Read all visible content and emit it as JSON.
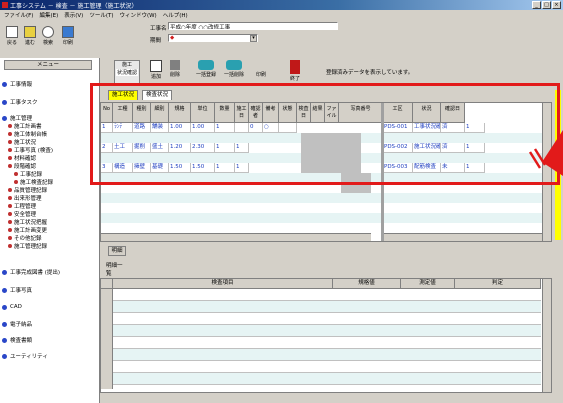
{
  "window": {
    "title": "工事システム － 検査 － 施工管理（施工状況）",
    "controls": [
      "_",
      "□",
      "×"
    ]
  },
  "menu": [
    "ファイル(F)",
    "編集(E)",
    "表示(V)",
    "ツール(T)",
    "ウィンドウ(W)",
    "ヘルプ(H)"
  ],
  "toolbar": [
    {
      "label": "戻る",
      "icon": "back-icon"
    },
    {
      "label": "進む",
      "icon": "forward-icon"
    },
    {
      "label": "検索",
      "icon": "search-icon"
    },
    {
      "label": "印刷",
      "icon": "print-icon"
    }
  ],
  "form": {
    "project_label": "工事名",
    "project_value": "平成○年度 ○○改修工事",
    "period_label": "期間",
    "period_value": "◆"
  },
  "sidebar": {
    "header": "メニュー",
    "items_top": [
      "工事情報",
      "工事タスク",
      "施工管理"
    ],
    "tree": [
      "施工計画書",
      "施工体制台帳",
      "施工状況",
      "工事写真 (検査)",
      "材料確認",
      "段階確認",
      "工事記録",
      "施工検査記録",
      "品質管理記録",
      "出来形管理",
      "工程管理",
      "安全管理",
      "施工状況把握",
      "施工計画変更",
      "その他記録",
      "施工管理記録"
    ],
    "items_bottom": [
      "工事完成図書 (提出)",
      "工事写真",
      "CAD",
      "電子納品",
      "検査書類",
      "ユーティリティ"
    ]
  },
  "ribbon": {
    "first_label": "施工",
    "first_sublabel": "状況確認",
    "buttons": [
      "追加",
      "削除",
      "一括登録",
      "一括削除",
      "印刷",
      "終了"
    ],
    "message": "登録済みデータを表示しています。"
  },
  "tabs": [
    "施工状況",
    "検査状況"
  ],
  "grid1": {
    "headers": [
      "No",
      "工種",
      "種別",
      "細別",
      "規格",
      "単位",
      "数量",
      "施工日",
      "確認者",
      "備考",
      "状態",
      "検査日",
      "結果",
      "ファイル",
      "写真番号",
      "工区",
      "状況",
      "確認日"
    ],
    "rows": [
      {
        "no": "1",
        "cells": [
          "ﾗﾝﾃ",
          "道路",
          "舗装",
          "1.00",
          "1.00",
          "1",
          "",
          "0",
          "○",
          "",
          "PDS-001",
          "工事状況確認",
          "済",
          "1"
        ]
      },
      {
        "no": "2",
        "cells": [
          "土工",
          "掘削",
          "盛土",
          "1.20",
          "2.30",
          "1",
          "1",
          "",
          "",
          "",
          "PDS-002",
          "施工状況確認",
          "済",
          "1"
        ]
      },
      {
        "no": "3",
        "cells": [
          "構造",
          "擁壁",
          "基礎",
          "1.50",
          "1.50",
          "1",
          "1",
          "",
          "",
          "",
          "PDS-003",
          "配筋検査",
          "未",
          "1"
        ]
      }
    ]
  },
  "lower": {
    "label": "明細",
    "tab": "明細一覧",
    "headers": [
      "検査項目",
      "規格値",
      "測定値",
      "判定"
    ]
  },
  "colors": {
    "highlight": "#e21a1a",
    "row_alt": "#e6f4f4",
    "grey_cell": "#c0c0c0",
    "accent_yellow": "#ffff00",
    "title_blue": "#0a246a"
  }
}
